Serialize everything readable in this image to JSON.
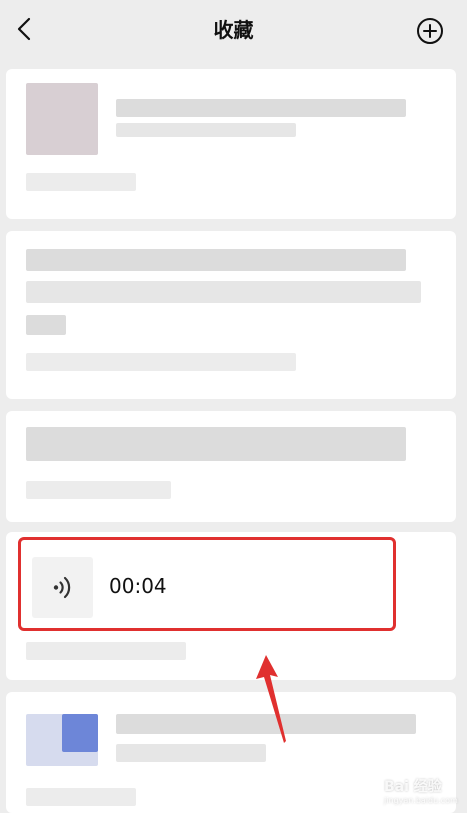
{
  "nav": {
    "title": "收藏",
    "back_icon": "chevron-left-icon",
    "add_icon": "plus-circle-icon"
  },
  "voice_item": {
    "duration": "00:04",
    "icon": "voice-wave-icon"
  },
  "colors": {
    "background": "#ededed",
    "card": "#ffffff",
    "highlight": "#e0302f"
  },
  "watermark": {
    "text": "Bai 经验",
    "url_text": "jingyan.baidu.com"
  }
}
